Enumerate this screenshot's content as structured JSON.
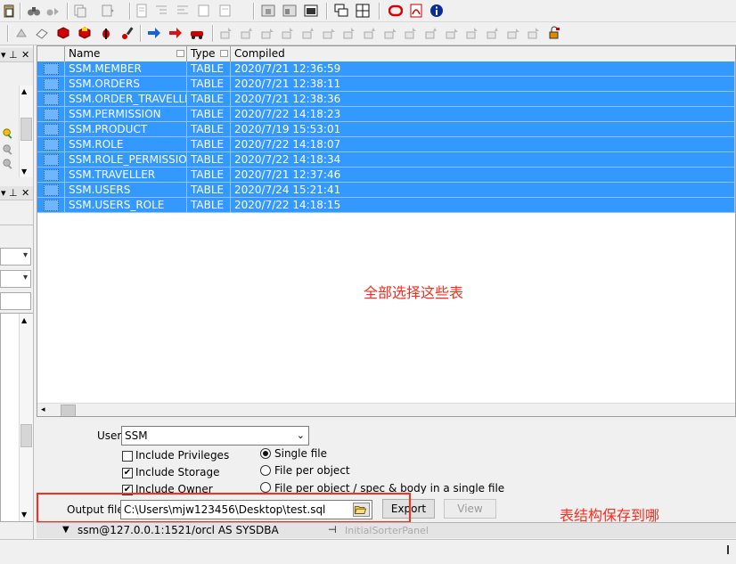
{
  "toolbar_top": {
    "icons": [
      "clipboard-icon",
      "binoculars-icon",
      "find-next-icon",
      "copy-icon",
      "paste-icon",
      "doc-icon",
      "indent-icon",
      "outdent-icon",
      "comment-icon",
      "uncomment-icon",
      "sql-window-icon",
      "command-window-icon",
      "report-window-icon",
      "cascade-icon",
      "tile-icon",
      "oracle-icon",
      "pdf-icon",
      "info-icon"
    ]
  },
  "toolbar_second": {
    "icons": [
      "compile-icon",
      "eraser-icon",
      "red-cube-icon",
      "yellow-red-cube-icon",
      "bug-icon",
      "brush-icon",
      "arrow-right-blue-icon",
      "arrow-right-red-icon",
      "red-car-icon",
      "step-icon-1",
      "step-icon-2",
      "step-icon-3",
      "step-icon-4",
      "step-icon-5",
      "step-icon-6",
      "step-icon-7",
      "step-icon-8",
      "step-icon-9",
      "step-icon-10",
      "step-icon-11",
      "step-icon-12",
      "step-icon-13",
      "step-icon-14",
      "lock-icon"
    ]
  },
  "grid": {
    "columns": [
      "Name",
      "Type",
      "Compiled"
    ],
    "rows": [
      {
        "name": "SSM.MEMBER",
        "type": "TABLE",
        "compiled": "2020/7/21 12:36:59"
      },
      {
        "name": "SSM.ORDERS",
        "type": "TABLE",
        "compiled": "2020/7/21 12:38:11"
      },
      {
        "name": "SSM.ORDER_TRAVELLER",
        "type": "TABLE",
        "compiled": "2020/7/21 12:38:36"
      },
      {
        "name": "SSM.PERMISSION",
        "type": "TABLE",
        "compiled": "2020/7/22 14:18:23"
      },
      {
        "name": "SSM.PRODUCT",
        "type": "TABLE",
        "compiled": "2020/7/19 15:53:01"
      },
      {
        "name": "SSM.ROLE",
        "type": "TABLE",
        "compiled": "2020/7/22 14:18:07"
      },
      {
        "name": "SSM.ROLE_PERMISSION",
        "type": "TABLE",
        "compiled": "2020/7/22 14:18:34"
      },
      {
        "name": "SSM.TRAVELLER",
        "type": "TABLE",
        "compiled": "2020/7/21 12:37:46"
      },
      {
        "name": "SSM.USERS",
        "type": "TABLE",
        "compiled": "2020/7/24 15:21:41"
      },
      {
        "name": "SSM.USERS_ROLE",
        "type": "TABLE",
        "compiled": "2020/7/22 14:18:15"
      }
    ],
    "selection_color": "#3399ff"
  },
  "annotations": {
    "select_all": "全部选择这些表",
    "save_to": "表结构保存到哪",
    "color": "#ff2b1c"
  },
  "options": {
    "user_label": "User",
    "user_value": "SSM",
    "include_privileges": {
      "label": "Include Privileges",
      "checked": false
    },
    "include_storage": {
      "label": "Include Storage",
      "checked": true
    },
    "include_owner": {
      "label": "Include Owner",
      "checked": true
    },
    "single_file": {
      "label": "Single file",
      "selected": true
    },
    "file_per_object": {
      "label": "File per object",
      "selected": false
    },
    "file_per_object_spec": {
      "label": "File per object / spec & body in a single file",
      "selected": false
    },
    "output_file_label": "Output file",
    "output_file_value": "C:\\Users\\mjw123456\\Desktop\\test.sql",
    "export_label": "Export",
    "view_label": "View"
  },
  "status": {
    "connection": "ssm@127.0.0.1:1521/orcl AS SYSDBA",
    "panel": "InitialSorterPanel"
  }
}
